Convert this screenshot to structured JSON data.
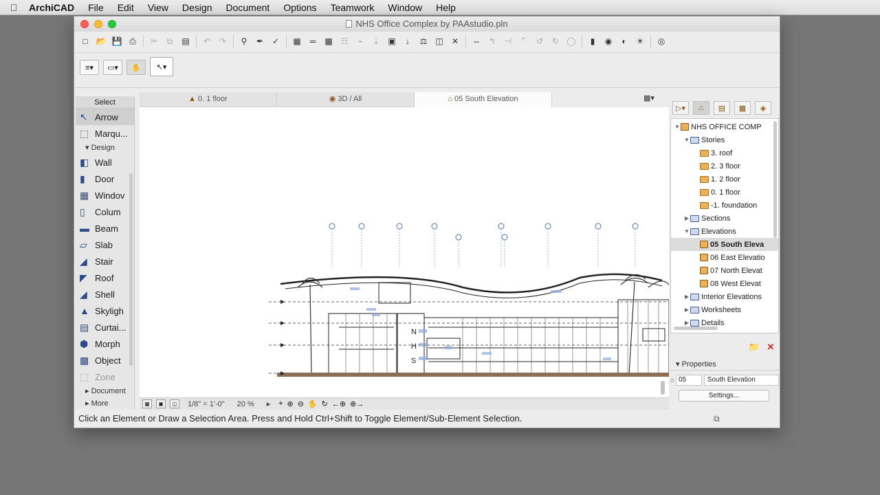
{
  "menubar": {
    "app": "ArchiCAD",
    "items": [
      "File",
      "Edit",
      "View",
      "Design",
      "Document",
      "Options",
      "Teamwork",
      "Window",
      "Help"
    ]
  },
  "window": {
    "title": "NHS Office Complex by PAAstudio.pln"
  },
  "toolbox": {
    "header": "Select",
    "select_tools": [
      {
        "label": "Arrow",
        "icon": "arrow-icon"
      },
      {
        "label": "Marqu...",
        "icon": "marquee-icon"
      }
    ],
    "design_group": "Design",
    "design_tools": [
      {
        "label": "Wall",
        "icon": "wall-icon"
      },
      {
        "label": "Door",
        "icon": "door-icon"
      },
      {
        "label": "Windov",
        "icon": "window-icon"
      },
      {
        "label": "Colum",
        "icon": "column-icon"
      },
      {
        "label": "Beam",
        "icon": "beam-icon"
      },
      {
        "label": "Slab",
        "icon": "slab-icon"
      },
      {
        "label": "Stair",
        "icon": "stair-icon"
      },
      {
        "label": "Roof",
        "icon": "roof-icon"
      },
      {
        "label": "Shell",
        "icon": "shell-icon"
      },
      {
        "label": "Skyligh",
        "icon": "skylight-icon"
      },
      {
        "label": "Curtai...",
        "icon": "curtain-wall-icon"
      },
      {
        "label": "Morph",
        "icon": "morph-icon"
      },
      {
        "label": "Object",
        "icon": "object-icon"
      },
      {
        "label": "Zone",
        "icon": "zone-icon"
      }
    ],
    "document_group": "Document",
    "more_group": "More"
  },
  "tabs": [
    {
      "label": "0. 1 floor"
    },
    {
      "label": "3D / All"
    },
    {
      "label": "05 South Elevation"
    }
  ],
  "bottombar": {
    "scale": "1/8\"",
    "scale_unit": "1'-0\"",
    "zoom": "20 %"
  },
  "elevation": {
    "letters": [
      "N",
      "H",
      "S"
    ]
  },
  "status_text": "Click an Element or Draw a Selection Area. Press and Hold Ctrl+Shift to Toggle Element/Sub-Element Selection.",
  "navigator": {
    "root": "NHS OFFICE COMP",
    "stories_label": "Stories",
    "stories": [
      "3. roof",
      "2. 3 floor",
      "1. 2 floor",
      "0. 1 floor",
      "-1. foundation"
    ],
    "sections_label": "Sections",
    "elevations_label": "Elevations",
    "elevations": [
      "05 South Eleva",
      "06 East Elevatio",
      "07 North Elevat",
      "08 West Elevat"
    ],
    "interior_label": "Interior Elevations",
    "worksheets_label": "Worksheets",
    "details_label": "Details"
  },
  "properties": {
    "header": "Properties",
    "id": "05",
    "name": "South Elevation",
    "settings_label": "Settings..."
  },
  "colors": {
    "accent_blue": "#4a6fb5",
    "folder": "#e8b15a",
    "close_red": "#fd5f57"
  }
}
